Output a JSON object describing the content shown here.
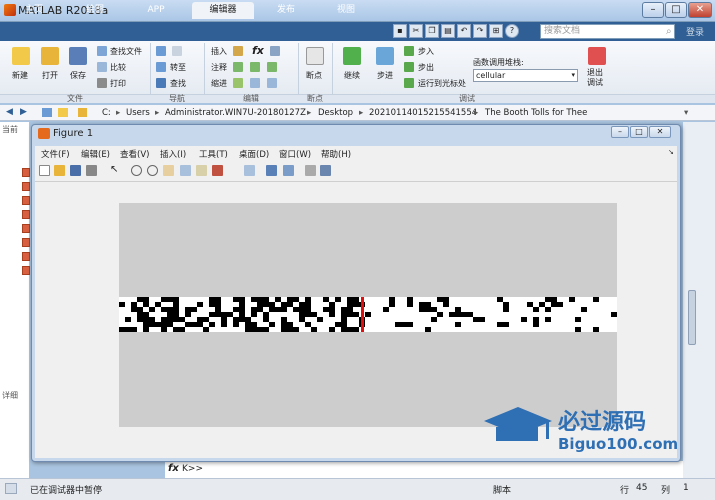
{
  "app": {
    "title": "MATLAB R2018a"
  },
  "tabs": [
    "主页",
    "绘图",
    "APP",
    "编辑器",
    "发布",
    "视图"
  ],
  "search": {
    "placeholder": "搜索文档",
    "login": "登录"
  },
  "ribbon": {
    "groups": [
      "文件",
      "导航",
      "编辑",
      "断点",
      "调试"
    ],
    "file": {
      "new": "新建",
      "open": "打开",
      "save": "保存",
      "find_files": "查找文件",
      "compare": "比较",
      "print": "打印"
    },
    "nav": {
      "goto": "转至",
      "find": "查找"
    },
    "edit": {
      "insert": "插入",
      "comment": "注释",
      "indent": "缩进",
      "fx": "fx"
    },
    "breakpoints": {
      "label": "断点"
    },
    "debug": {
      "continue": "继续",
      "step": "步进",
      "step_in": "步入",
      "step_out": "步出",
      "run_to_cursor": "运行到光标处",
      "stack_label": "函数调用堆栈:",
      "stack_value": "cellular",
      "quit": "退出\n调试"
    }
  },
  "path": [
    "C:",
    "Users",
    "Administrator.WIN7U-20180127Z",
    "Desktop",
    "20210114015215541554",
    "The Booth Tolls for Thee"
  ],
  "left": {
    "current_folder": "当前",
    "details": "详细"
  },
  "figure": {
    "title": "Figure 1",
    "menus": [
      "文件(F)",
      "编辑(E)",
      "查看(V)",
      "插入(I)",
      "工具(T)",
      "桌面(D)",
      "窗口(W)",
      "帮助(H)"
    ]
  },
  "watermark": {
    "cn": "必过源码",
    "en": "Biguo100.com"
  },
  "command": {
    "prompt": "fx",
    "text": "K>>"
  },
  "status": {
    "left": "已在调试器中暂停",
    "script": "脚本",
    "row_label": "行",
    "row": "45",
    "col_label": "列",
    "col": "1"
  },
  "colors": {
    "titlebar": "#aac6e6",
    "tabbar": "#2f5f94",
    "plot_bg": "#cdcdcd"
  }
}
